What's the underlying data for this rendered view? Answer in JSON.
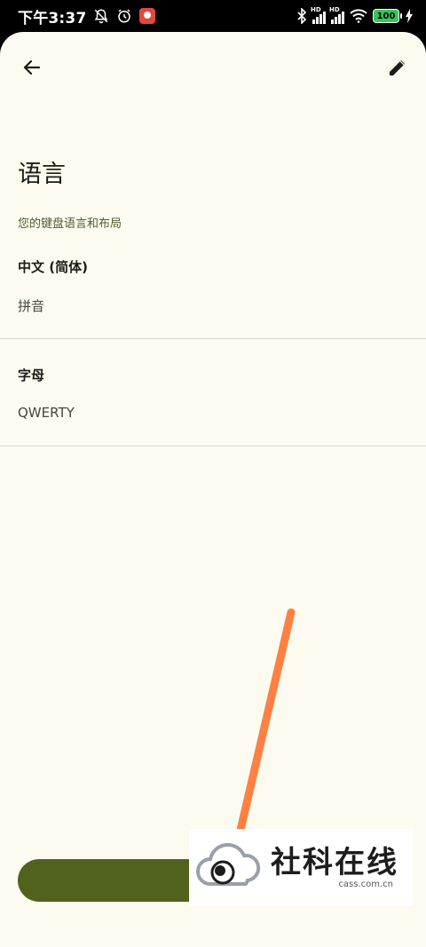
{
  "status_bar": {
    "time": "下午3:37",
    "battery": "100",
    "hd_label": "HD",
    "icons": [
      "notification-muted-icon",
      "alarm-icon",
      "app-badge-icon",
      "bluetooth-icon",
      "signal-icon",
      "wifi-icon",
      "battery-icon",
      "charging-icon"
    ]
  },
  "toolbar": {
    "back_icon": "arrow-back-icon",
    "edit_icon": "pencil-icon"
  },
  "page": {
    "title": "语言",
    "subtitle": "您的键盘语言和布局"
  },
  "languages": [
    {
      "name": "中文 (简体)",
      "layout": "拼音"
    },
    {
      "name": "字母",
      "layout": "QWERTY"
    }
  ],
  "watermark": {
    "brand": "社科在线",
    "domain": "cass.com.cn"
  },
  "colors": {
    "background": "#fdfbf0",
    "accent": "#51621d",
    "subtitle": "#4f5b2a",
    "annotation_arrow": "#ff8043"
  }
}
